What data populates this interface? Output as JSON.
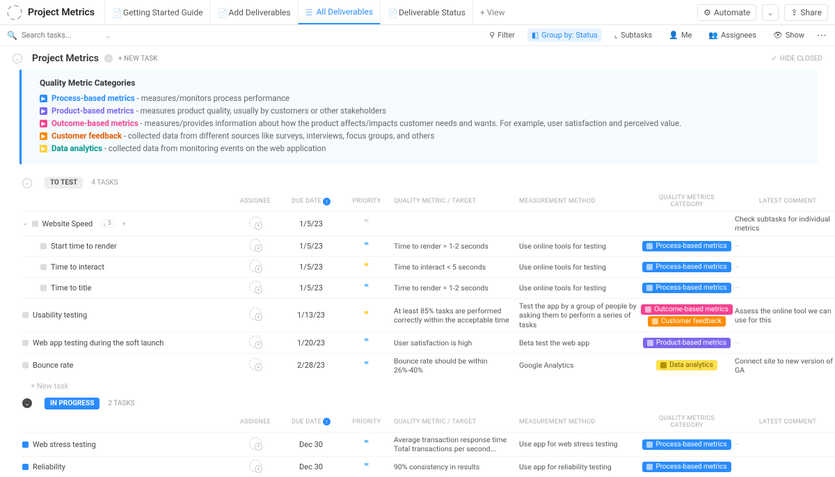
{
  "project_title": "Project Metrics",
  "tabs": [
    "Getting Started Guide",
    "Add Deliverables",
    "All Deliverables",
    "Deliverable Status"
  ],
  "active_tab": 2,
  "add_view": "+ View",
  "automate_label": "Automate",
  "share_label": "Share",
  "search_placeholder": "Search tasks...",
  "toolbar": {
    "filter": "Filter",
    "group": "Group by: Status",
    "subtasks": "Subtasks",
    "me": "Me",
    "assignees": "Assignees",
    "show": "Show"
  },
  "section": {
    "title": "Project Metrics",
    "new_task": "+ NEW TASK",
    "hide_closed": "HIDE CLOSED"
  },
  "info": {
    "heading": "Quality Metric Categories",
    "lines": [
      {
        "color": "blue",
        "name": "Process-based metrics",
        "desc": " - measures/monitors process performance"
      },
      {
        "color": "purple",
        "name": "Product-based metrics",
        "desc": " - measures product quality, usually by  customers or other stakeholders"
      },
      {
        "color": "pink",
        "name": "Outcome-based metrics",
        "desc": " - measures/provides information about how the product affects/impacts customer needs and wants. For example, user satisfaction and perceived value."
      },
      {
        "color": "orange",
        "name": "Customer feedback",
        "desc": " - collected data from different sources like surveys, interviews, focus groups, and others"
      },
      {
        "color": "teal",
        "name": "Data analytics",
        "desc": " - collected data from monitoring events on the web application"
      }
    ]
  },
  "columns": [
    "",
    "ASSIGNEE",
    "DUE DATE",
    "PRIORITY",
    "QUALITY METRIC / TARGET",
    "MEASUREMENT METHOD",
    "QUALITY METRICS CATEGORY",
    "LATEST COMMENT"
  ],
  "groups": [
    {
      "status": "TO TEST",
      "pill": "test",
      "count": "4 TASKS",
      "rows": [
        {
          "name": "Website Speed",
          "indent": false,
          "caret": true,
          "sub_badge": "3",
          "plus": true,
          "due": "1/5/23",
          "flag": "grey",
          "metric": "",
          "method": "",
          "tags": [],
          "comment": "Check subtasks for individual metrics"
        },
        {
          "name": "Start time to render",
          "indent": true,
          "due": "1/5/23",
          "flag": "blue",
          "metric": "Time to render = 1-2 seconds",
          "method": "Use online tools for testing",
          "tags": [
            {
              "t": "Process-based metrics",
              "c": "blue"
            }
          ],
          "comment": "–"
        },
        {
          "name": "Time to interact",
          "indent": true,
          "due": "1/5/23",
          "flag": "yellow",
          "metric": "Time to interact < 5 seconds",
          "method": "Use online tools for testing",
          "tags": [
            {
              "t": "Process-based metrics",
              "c": "blue"
            }
          ],
          "comment": "–"
        },
        {
          "name": "Time to title",
          "indent": true,
          "due": "1/5/23",
          "flag": "blue",
          "metric": "Time to render = 1-2 seconds",
          "method": "Use online tools for testing",
          "tags": [
            {
              "t": "Process-based metrics",
              "c": "blue"
            }
          ],
          "comment": "–"
        },
        {
          "name": "Usability testing",
          "indent": false,
          "due": "1/13/23",
          "flag": "yellow",
          "metric": "At least 85% tasks are performed correctly within the acceptable time",
          "method": "Test the app by a group of people by asking them to perform a series of tasks",
          "tags": [
            {
              "t": "Outcome-based metrics",
              "c": "pink"
            },
            {
              "t": "Customer feedback",
              "c": "orange"
            }
          ],
          "comment": "Assess the online tool we can use for this"
        },
        {
          "name": "Web app testing during the soft launch",
          "indent": false,
          "due": "1/20/23",
          "flag": "blue",
          "metric": "User satisfaction is high",
          "method": "Beta test the web app",
          "tags": [
            {
              "t": "Product-based metrics",
              "c": "purple"
            }
          ],
          "comment": "–"
        },
        {
          "name": "Bounce rate",
          "indent": false,
          "due": "2/28/23",
          "flag": "blue",
          "metric": "Bounce rate should be within 26%-40%",
          "method": "Google Analytics",
          "tags": [
            {
              "t": "Data analytics",
              "c": "yellow"
            }
          ],
          "comment": "Connect site to new version of GA"
        }
      ],
      "new_task": "+ New task"
    },
    {
      "status": "IN PROGRESS",
      "pill": "prog",
      "count": "2 TASKS",
      "rows": [
        {
          "name": "Web stress testing",
          "indent": false,
          "statblue": true,
          "due": "Dec 30",
          "flag": "blue",
          "metric": "Average transaction response time\nTotal transactions per second...",
          "method": "Use app for web stress testing",
          "tags": [
            {
              "t": "Process-based metrics",
              "c": "blue"
            }
          ],
          "comment": "–"
        },
        {
          "name": "Reliability",
          "indent": false,
          "statblue": true,
          "due": "Dec 30",
          "flag": "blue",
          "metric": "90% consistency in results",
          "method": "Use app for reliability testing",
          "tags": [
            {
              "t": "Process-based metrics",
              "c": "blue"
            }
          ],
          "comment": ""
        }
      ]
    }
  ]
}
